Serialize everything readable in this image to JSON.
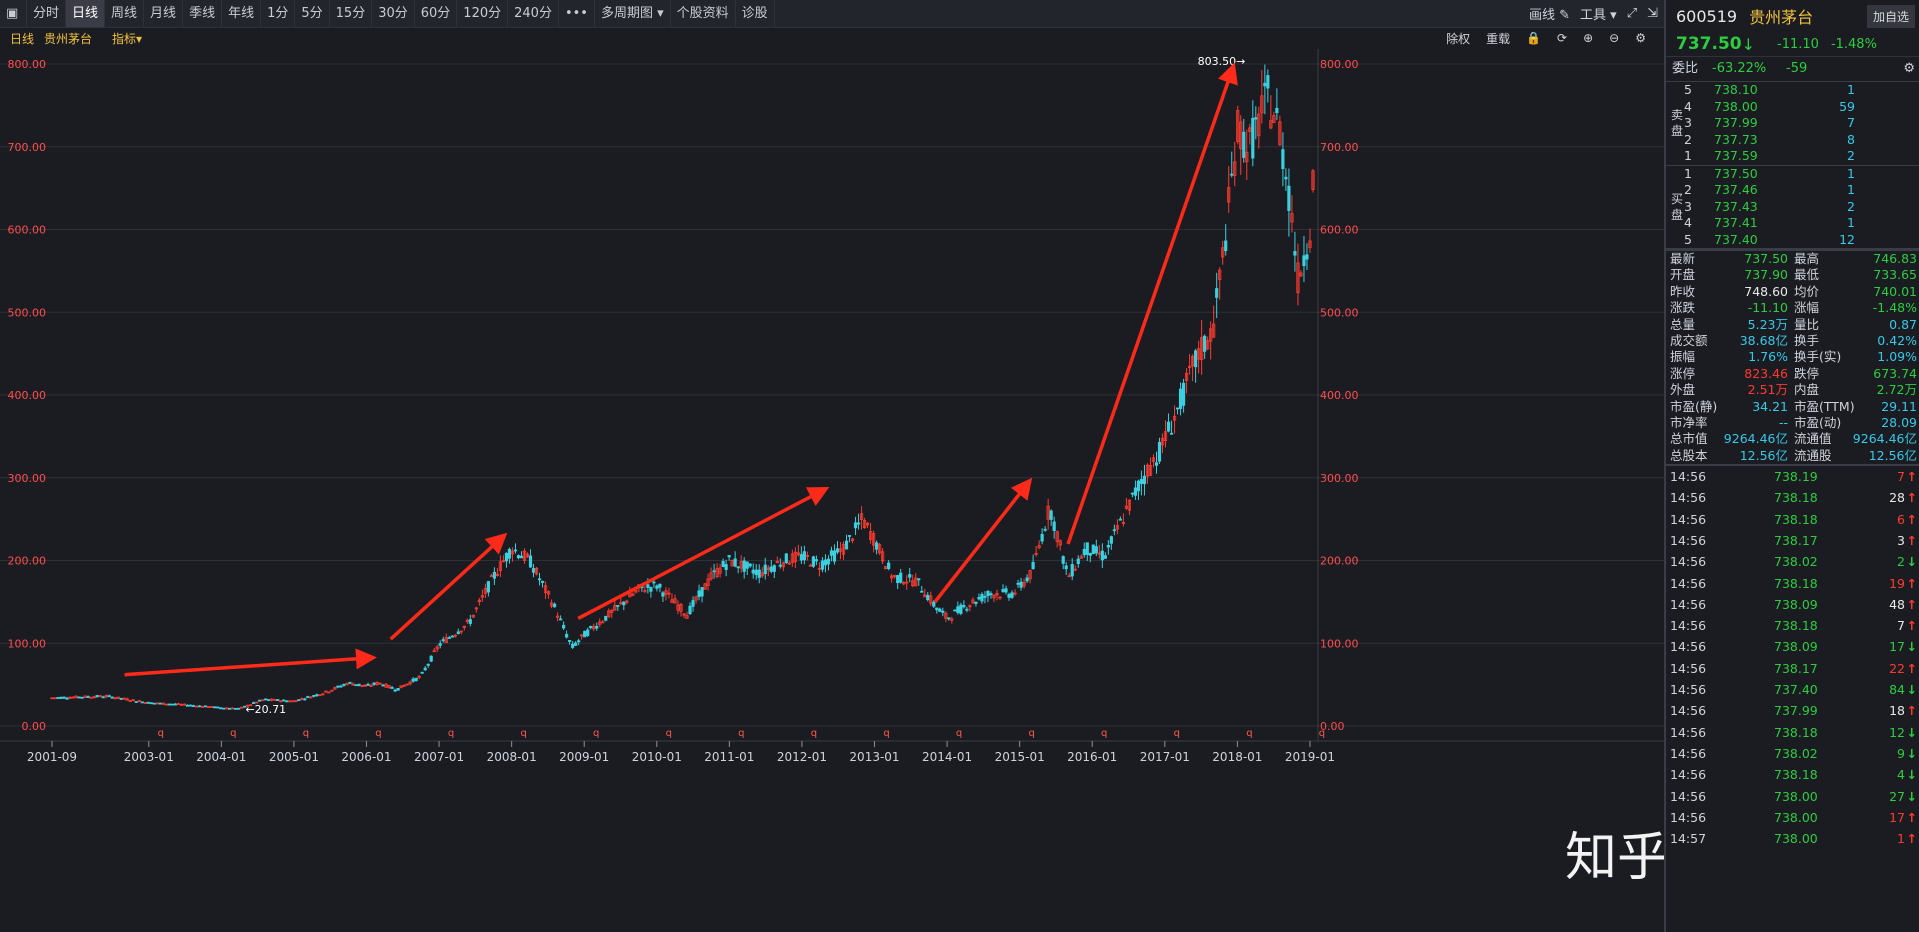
{
  "toolbar": {
    "tabs": [
      "分时",
      "日线",
      "周线",
      "月线",
      "季线",
      "年线",
      "1分",
      "5分",
      "15分",
      "30分",
      "60分",
      "120分",
      "240分"
    ],
    "active_tab": "日线",
    "more": "•••",
    "multi_period": "多周期图",
    "stock_info": "个股资料",
    "diagnose": "诊股",
    "draw": "画线",
    "tools": "工具"
  },
  "subbar": {
    "period": "日线",
    "stock": "贵州茅台",
    "indicator": "指标",
    "fq": "除权",
    "reload": "重载"
  },
  "chart_data": {
    "type": "candlestick",
    "ylim": [
      0,
      800
    ],
    "y_ticks": [
      "0.00",
      "100.00",
      "200.00",
      "300.00",
      "400.00",
      "500.00",
      "600.00",
      "700.00",
      "800.00"
    ],
    "y_values": [
      0,
      100,
      200,
      300,
      400,
      500,
      600,
      700,
      800
    ],
    "x_ticks": [
      "2001-09",
      "2003-01",
      "2004-01",
      "2005-01",
      "2006-01",
      "2007-01",
      "2008-01",
      "2009-01",
      "2010-01",
      "2011-01",
      "2012-01",
      "2013-01",
      "2014-01",
      "2015-01",
      "2016-01",
      "2017-01",
      "2018-01",
      "2019-01"
    ],
    "max_label": "803.50",
    "min_label": "20.71",
    "trend": [
      [
        "2001-09",
        34
      ],
      [
        "2002-06",
        36
      ],
      [
        "2003-01",
        28
      ],
      [
        "2003-06",
        26
      ],
      [
        "2004-01",
        22
      ],
      [
        "2004-04",
        21
      ],
      [
        "2004-08",
        32
      ],
      [
        "2005-01",
        30
      ],
      [
        "2005-06",
        40
      ],
      [
        "2005-10",
        52
      ],
      [
        "2006-01",
        48
      ],
      [
        "2006-03",
        52
      ],
      [
        "2006-06",
        44
      ],
      [
        "2006-10",
        60
      ],
      [
        "2007-01",
        98
      ],
      [
        "2007-06",
        125
      ],
      [
        "2007-10",
        180
      ],
      [
        "2008-01",
        215
      ],
      [
        "2008-04",
        200
      ],
      [
        "2008-08",
        145
      ],
      [
        "2008-11",
        95
      ],
      [
        "2009-01",
        110
      ],
      [
        "2009-06",
        140
      ],
      [
        "2009-10",
        165
      ],
      [
        "2010-01",
        170
      ],
      [
        "2010-06",
        135
      ],
      [
        "2010-10",
        180
      ],
      [
        "2011-01",
        200
      ],
      [
        "2011-06",
        185
      ],
      [
        "2011-10",
        200
      ],
      [
        "2012-01",
        205
      ],
      [
        "2012-04",
        195
      ],
      [
        "2012-08",
        215
      ],
      [
        "2012-11",
        250
      ],
      [
        "2013-01",
        225
      ],
      [
        "2013-04",
        180
      ],
      [
        "2013-08",
        175
      ],
      [
        "2013-11",
        145
      ],
      [
        "2014-01",
        130
      ],
      [
        "2014-04",
        145
      ],
      [
        "2014-08",
        160
      ],
      [
        "2014-12",
        160
      ],
      [
        "2015-03",
        185
      ],
      [
        "2015-06",
        265
      ],
      [
        "2015-09",
        180
      ],
      [
        "2015-12",
        215
      ],
      [
        "2016-03",
        205
      ],
      [
        "2016-06",
        250
      ],
      [
        "2016-09",
        295
      ],
      [
        "2016-12",
        330
      ],
      [
        "2017-03",
        380
      ],
      [
        "2017-06",
        440
      ],
      [
        "2017-09",
        480
      ],
      [
        "2017-11",
        590
      ],
      [
        "2018-01",
        720
      ],
      [
        "2018-03",
        700
      ],
      [
        "2018-06",
        760
      ],
      [
        "2018-08",
        720
      ],
      [
        "2018-10",
        620
      ],
      [
        "2018-11",
        540
      ],
      [
        "2019-01",
        600
      ],
      [
        "2019-02",
        720
      ]
    ]
  },
  "right_panel": {
    "code": "600519",
    "name": "贵州茅台",
    "add": "加自选",
    "price": "737.50",
    "change": "-11.10",
    "change_pct": "-1.48%",
    "weibi_label": "委比",
    "weibi": "-63.22%",
    "weicha": "-59",
    "sell_label": "卖盘",
    "buy_label": "买盘",
    "sells": [
      {
        "n": "5",
        "p": "738.10",
        "v": "1"
      },
      {
        "n": "4",
        "p": "738.00",
        "v": "59"
      },
      {
        "n": "3",
        "p": "737.99",
        "v": "7"
      },
      {
        "n": "2",
        "p": "737.73",
        "v": "8"
      },
      {
        "n": "1",
        "p": "737.59",
        "v": "2"
      }
    ],
    "buys": [
      {
        "n": "1",
        "p": "737.50",
        "v": "1"
      },
      {
        "n": "2",
        "p": "737.46",
        "v": "1"
      },
      {
        "n": "3",
        "p": "737.43",
        "v": "2"
      },
      {
        "n": "4",
        "p": "737.41",
        "v": "1"
      },
      {
        "n": "5",
        "p": "737.40",
        "v": "12"
      }
    ],
    "stats": [
      [
        "最新",
        "737.50",
        "green",
        "最高",
        "746.83",
        "green"
      ],
      [
        "开盘",
        "737.90",
        "green",
        "最低",
        "733.65",
        "green"
      ],
      [
        "昨收",
        "748.60",
        "white",
        "均价",
        "740.01",
        "green"
      ],
      [
        "涨跌",
        "-11.10",
        "green",
        "涨幅",
        "-1.48%",
        "green"
      ],
      [
        "总量",
        "5.23万",
        "cyan",
        "量比",
        "0.87",
        "cyan"
      ],
      [
        "成交额",
        "38.68亿",
        "cyan",
        "换手",
        "0.42%",
        "cyan"
      ],
      [
        "振幅",
        "1.76%",
        "cyan",
        "换手(实)",
        "1.09%",
        "cyan"
      ],
      [
        "涨停",
        "823.46",
        "red",
        "跌停",
        "673.74",
        "green"
      ],
      [
        "外盘",
        "2.51万",
        "red",
        "内盘",
        "2.72万",
        "green"
      ],
      [
        "市盈(静)",
        "34.21",
        "cyan",
        "市盈(TTM)",
        "29.11",
        "cyan"
      ],
      [
        "市净率",
        "--",
        "cyan",
        "市盈(动)",
        "28.09",
        "cyan"
      ],
      [
        "总市值",
        "9264.46亿",
        "cyan",
        "流通值",
        "9264.46亿",
        "cyan"
      ],
      [
        "总股本",
        "12.56亿",
        "cyan",
        "流通股",
        "12.56亿",
        "cyan"
      ]
    ],
    "ticks": [
      [
        "14:56",
        "738.19",
        "7",
        "red",
        "↑"
      ],
      [
        "14:56",
        "738.18",
        "28",
        "white",
        "↑"
      ],
      [
        "14:56",
        "738.18",
        "6",
        "red",
        "↑"
      ],
      [
        "14:56",
        "738.17",
        "3",
        "white",
        "↑"
      ],
      [
        "14:56",
        "738.02",
        "2",
        "green",
        "↓"
      ],
      [
        "14:56",
        "738.18",
        "19",
        "red",
        "↑"
      ],
      [
        "14:56",
        "738.09",
        "48",
        "white",
        "↑"
      ],
      [
        "14:56",
        "738.18",
        "7",
        "white",
        "↑"
      ],
      [
        "14:56",
        "738.09",
        "17",
        "green",
        "↓"
      ],
      [
        "14:56",
        "738.17",
        "22",
        "red",
        "↑"
      ],
      [
        "14:56",
        "737.40",
        "84",
        "green",
        "↓"
      ],
      [
        "14:56",
        "737.99",
        "18",
        "white",
        "↑"
      ],
      [
        "14:56",
        "738.18",
        "12",
        "green",
        "↓"
      ],
      [
        "14:56",
        "738.02",
        "9",
        "green",
        "↓"
      ],
      [
        "14:56",
        "738.18",
        "4",
        "green",
        "↓"
      ],
      [
        "14:56",
        "738.00",
        "27",
        "green",
        "↓"
      ],
      [
        "14:56",
        "738.00",
        "17",
        "red",
        "↑"
      ],
      [
        "14:57",
        "738.00",
        "1",
        "red",
        "↑"
      ]
    ]
  },
  "watermark": "知乎 @豆芽",
  "colors": {
    "up": "#ff3b30",
    "down": "#3ad0e0",
    "grid": "#2e3038",
    "axis": "#ff4d4d",
    "arrow": "#ff2a1a"
  }
}
